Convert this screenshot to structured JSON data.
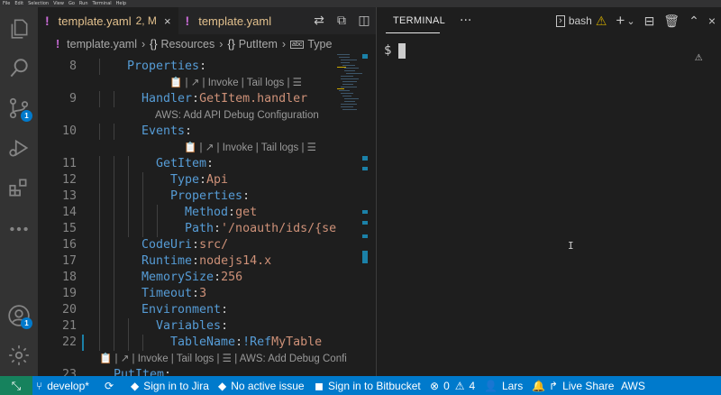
{
  "menubar": [
    "File",
    "Edit",
    "Selection",
    "View",
    "Go",
    "Run",
    "Terminal",
    "Help"
  ],
  "activity": {
    "source_control_badge": "1",
    "accounts_badge": "1"
  },
  "tabs": [
    {
      "label": "template.yaml",
      "modified": "2, M",
      "close": "×"
    },
    {
      "label": "template.yaml"
    }
  ],
  "breadcrumb": {
    "file": "template.yaml",
    "items": [
      "Resources",
      "PutItem",
      "Type"
    ],
    "braces": "{}",
    "abc": "abc"
  },
  "code_lines": [
    {
      "num": "8",
      "indent": 1,
      "key": "Properties",
      "value": ""
    },
    {
      "num": "9",
      "indent": 2,
      "key": "Handler",
      "value": "GetItem.handler"
    },
    {
      "num": "10",
      "indent": 2,
      "key": "Events",
      "value": ""
    },
    {
      "num": "11",
      "indent": 3,
      "key": "GetItem",
      "value": ""
    },
    {
      "num": "12",
      "indent": 4,
      "key": "Type",
      "value": "Api"
    },
    {
      "num": "13",
      "indent": 4,
      "key": "Properties",
      "value": ""
    },
    {
      "num": "14",
      "indent": 5,
      "key": "Method",
      "value": "get"
    },
    {
      "num": "15",
      "indent": 5,
      "key": "Path",
      "value": "'/noauth/ids/{se"
    },
    {
      "num": "16",
      "indent": 2,
      "key": "CodeUri",
      "value": "src/"
    },
    {
      "num": "17",
      "indent": 2,
      "key": "Runtime",
      "value": "nodejs14.x"
    },
    {
      "num": "18",
      "indent": 2,
      "key": "MemorySize",
      "value": "256"
    },
    {
      "num": "19",
      "indent": 2,
      "key": "Timeout",
      "value": "3"
    },
    {
      "num": "20",
      "indent": 2,
      "key": "Environment",
      "value": ""
    },
    {
      "num": "21",
      "indent": 3,
      "key": "Variables",
      "value": ""
    },
    {
      "num": "22",
      "indent": 4,
      "key": "TableName",
      "tag": "!Ref",
      "value": "MyTable"
    },
    {
      "num": "23",
      "indent": 0,
      "key": "PutItem",
      "value": ""
    }
  ],
  "codelens": {
    "after_8": "📋 | ↗ | Invoke | Tail logs | ☰",
    "after_9": "AWS: Add API Debug Configuration",
    "after_10": "📋 | ↗ | Invoke | Tail logs | ☰",
    "after_22": "📋 | ↗ | Invoke | Tail logs | ☰ | AWS: Add Debug Confi"
  },
  "terminal": {
    "tab_label": "TERMINAL",
    "more": "···",
    "shell_label": "bash",
    "prompt": "$",
    "add": "+",
    "chevron": "⌄"
  },
  "statusbar": {
    "remote_icon": "⤡",
    "branch": "develop*",
    "sync": "⟳",
    "jira": "Sign in to Jira",
    "issue": "No active issue",
    "bitbucket": "Sign in to Bitbucket",
    "errors": "0",
    "warnings": "4",
    "user": "Lars",
    "liveshare": "Live Share",
    "aws": "AWS"
  },
  "colors": {
    "accent": "#007acc",
    "remote": "#16825d",
    "yaml_icon": "#cb6cd8",
    "modified": "#e2c08d",
    "warning": "#cca700"
  }
}
